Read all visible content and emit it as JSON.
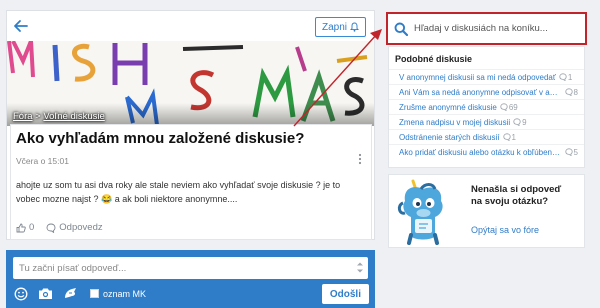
{
  "header": {
    "follow_label": "Zapni"
  },
  "breadcrumb": {
    "forum": "Fóra",
    "separator": " > ",
    "section": "Voľné diskusie"
  },
  "hero": {
    "art_text": [
      "MISH",
      "MASH"
    ]
  },
  "post": {
    "title": "Ako vyhľadám mnou založené diskusie?",
    "date": "Včera o 15:01",
    "body": "ahojte uz som tu asi dva roky ale stale neviem ako vyhľadať svoje diskusie ? je to vobec mozne najst ? 😂 a ak boli niektore anonymne....",
    "likes": "0",
    "reply_label": "Odpovedz"
  },
  "reply": {
    "placeholder": "Tu začni písať odpoveď...",
    "anonymous_label": "oznam MK",
    "send_label": "Odošli"
  },
  "search": {
    "placeholder": "Hľadaj v diskusiách na koníku..."
  },
  "similar": {
    "title": "Podobné diskusie",
    "items": [
      {
        "label": "V anonymnej diskusii sa mi nedá odpovedať",
        "count": "1"
      },
      {
        "label": "Ani Vám sa nedá anonymne odpisovať v anonymnej diskusii?",
        "count": "8"
      },
      {
        "label": "Zrušme anonymné diskusie",
        "count": "69"
      },
      {
        "label": "Zmena nadpisu v mojej diskusii",
        "count": "9"
      },
      {
        "label": "Odstránenie starých diskusií",
        "count": "1"
      },
      {
        "label": "Ako pridať diskusiu alebo otázku k obľúbeným?",
        "count": "5"
      }
    ]
  },
  "help": {
    "title": "Nenašla si odpoveď na svoju otázku?",
    "link": "Opýtaj sa vo fóre"
  },
  "colors": {
    "accent": "#2f7dc9",
    "annotation": "#c0252b",
    "background": "#eef0f3"
  }
}
